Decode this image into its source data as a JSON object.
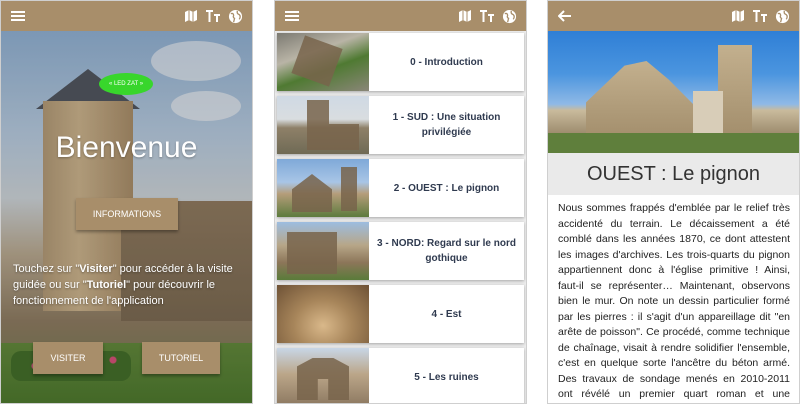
{
  "topbar_icons": [
    "menu-icon",
    "map-icon",
    "text-size-icon",
    "globe-icon"
  ],
  "colors": {
    "brand": "#a88e6a",
    "badge": "#38d62c",
    "title_text": "#2f3a4f"
  },
  "home": {
    "badge_text": "« LED ZAT »",
    "welcome": "Bienvenue",
    "info_button": "INFORMATIONS",
    "instructions": {
      "p1": "Touchez sur \"",
      "visiter": "Visiter",
      "p2": "\" pour accéder à la visite guidée ou sur \"",
      "tutoriel": "Tutoriel",
      "p3": "\" pour découvrir le fonctionnement de l'application"
    },
    "visit_button": "VISITER",
    "tutorial_button": "TUTORIEL"
  },
  "list": {
    "items": [
      {
        "label": "0 - Introduction"
      },
      {
        "label": "1 - SUD : Une situation privilégiée"
      },
      {
        "label": "2 - OUEST : Le pignon"
      },
      {
        "label": "3 - NORD: Regard sur le nord gothique"
      },
      {
        "label": "4 - Est"
      },
      {
        "label": "5 - Les ruines"
      }
    ]
  },
  "detail": {
    "back_icon": "arrow-left-icon",
    "title": "OUEST : Le pignon",
    "body": "Nous sommes frappés d'emblée par le relief très accidenté du terrain. Le décaissement a été comblé dans les années 1870, ce dont attestent les images d'archives. Les trois-quarts du pignon appartiennent donc à l'église primitive ! Ainsi, faut-il se représenter… Maintenant, observons bien le mur. On note un dessin particulier formé par les pierres : il s'agit d'un appareillage dit \"en arête de poisson\". Ce procédé, comme technique de chaînage, visait à rendre solidifier l'ensemble, c'est en quelque sorte l'ancêtre du béton armé. Des travaux de sondage menés en 2010-2011 ont révélé un premier quart roman et une extension"
  }
}
